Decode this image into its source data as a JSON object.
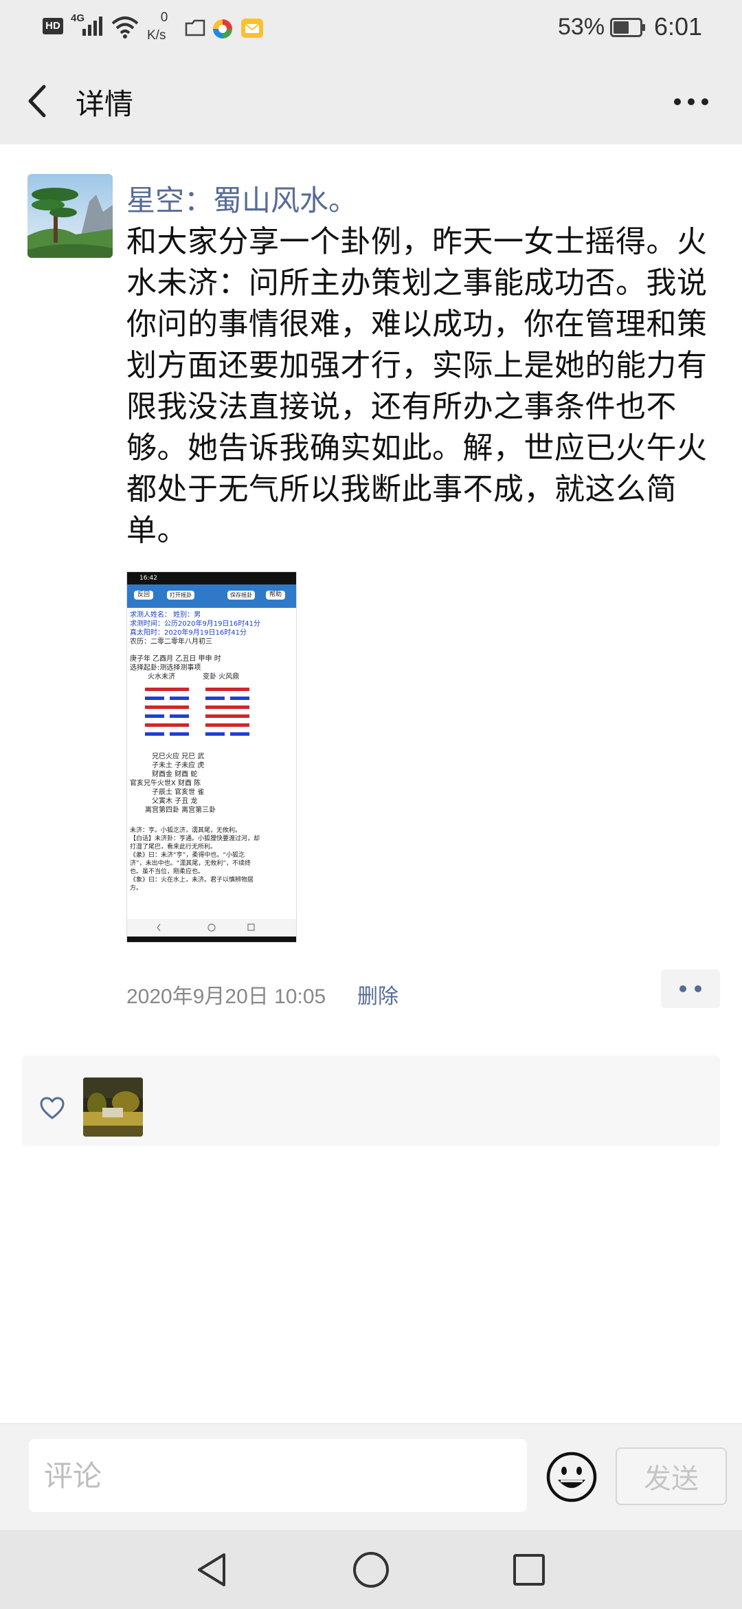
{
  "status_bar": {
    "hd": "HD",
    "network": "4G",
    "speed_value": "0",
    "speed_unit": "K/s",
    "battery_percent": "53%",
    "time": "6:01"
  },
  "header": {
    "title": "详情",
    "back_icon": "chevron-left-icon",
    "more_icon": "more-dots-icon"
  },
  "post": {
    "author": "星空：蜀山风水。",
    "text": "和大家分享一个卦例，昨天一女士摇得。火水未济：问所主办策划之事能成功否。我说你问的事情很难，难以成功，你在管理和策划方面还要加强才行，实际上是她的能力有限我没法直接说，还有所办之事条件也不够。她告诉我确实如此。解，世应已火午火都处于无气所以我断此事不成，就这么简单。",
    "timestamp": "2020年9月20日 10:05",
    "delete_label": "删除",
    "image": {
      "status_time": "16:42",
      "buttons": [
        "反回",
        "打开摇卦",
        "保存摇卦",
        "帮助"
      ],
      "info_lines": [
        "求测人姓名：      姓别：男",
        "求测时间：公历2020年9月19日16时41分",
        "真太阳时：2020年9月19日16时41分",
        "农历：二零二零年八月初三"
      ],
      "ganzhi": "庚子年 乙酉月 乙丑日 甲申 时",
      "select_line": "选择起卦:测选择测事项",
      "hexagram_left": "火水未济",
      "hexagram_right": "变卦 火风鼎",
      "yao_lines": [
        "兄巳火应   兄巳    武",
        "子未土     子未应 虎",
        "财酉金     财酉    蛇",
        "官亥兄午火世X  财酉    陈",
        "子辰土     官亥世 雀",
        "父寅木     子丑    龙",
        "离宫第四卦      离宫第三卦"
      ],
      "text_lines": [
        "未济：亨。小狐汔济，濡其尾，无攸利。",
        "【白话】未济卦：亨通。小狐狸快要渡过河，却",
        "打湿了尾巴，看来此行无所利。",
        "《彖》曰：未济“亨”，柔得中也。“小狐汔",
        "济”，未出中也。“濡其尾，无攸利”，不续终",
        "也。虽不当位，刚柔应也。",
        "《象》曰：火在水上，未济。君子以慎辨物居",
        "方。"
      ]
    }
  },
  "likes": {
    "heart_icon": "heart-outline-icon"
  },
  "comment": {
    "placeholder": "评论",
    "send_label": "发送",
    "emoji_icon": "smiley-icon"
  },
  "nav": {
    "back_icon": "triangle-back-icon",
    "home_icon": "circle-home-icon",
    "recent_icon": "square-recent-icon"
  },
  "colors": {
    "link": "#576b95",
    "header_bg": "#ededed",
    "yang_red": "#d0262b",
    "yin_blue": "#1f3fd8"
  }
}
